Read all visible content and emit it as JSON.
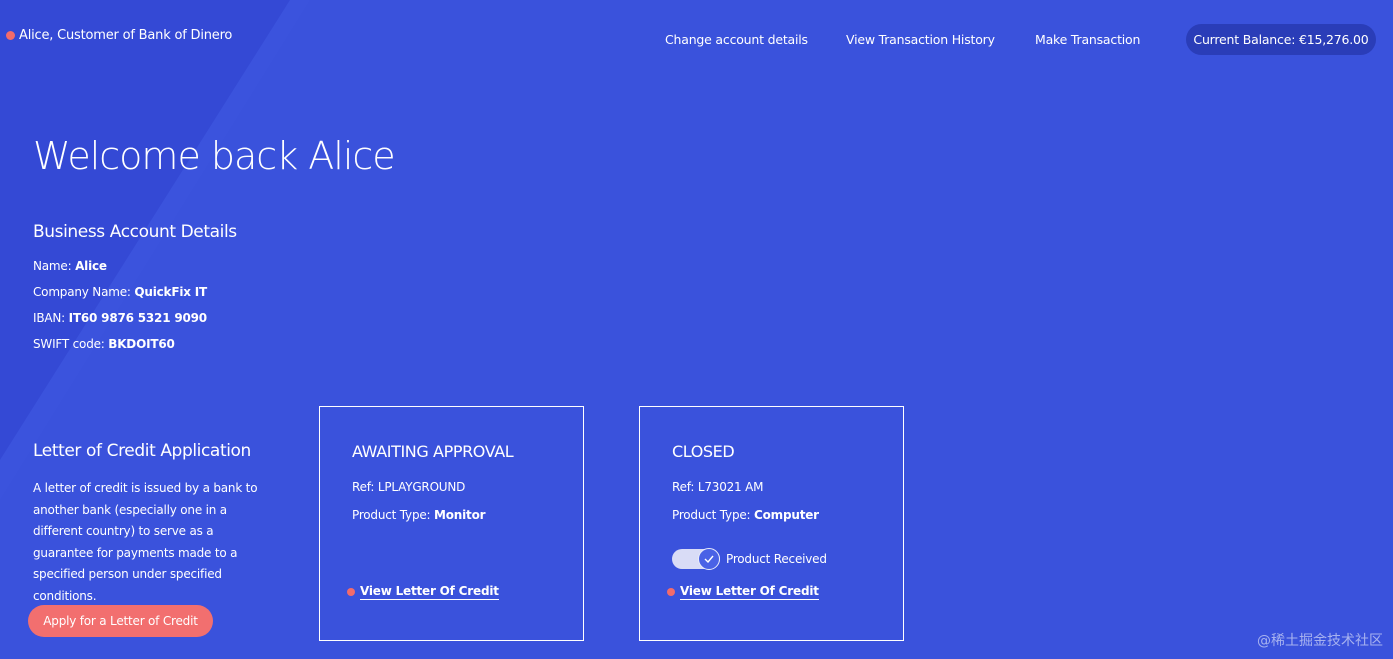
{
  "header": {
    "user_label": "Alice, Customer of Bank of Dinero",
    "nav": [
      {
        "label": "Change account details"
      },
      {
        "label": "View Transaction History"
      },
      {
        "label": "Make Transaction"
      }
    ],
    "balance_label": "Current Balance: €15,276.00"
  },
  "welcome": "Welcome back Alice",
  "account": {
    "title": "Business Account Details",
    "fields": [
      {
        "label": "Name:",
        "value": "Alice"
      },
      {
        "label": "Company Name:",
        "value": "QuickFix IT"
      },
      {
        "label": "IBAN:",
        "value": "IT60 9876 5321 9090"
      },
      {
        "label": "SWIFT code:",
        "value": "BKDOIT60"
      }
    ]
  },
  "loc": {
    "title": "Letter of Credit Application",
    "description": "A letter of credit is issued by a bank to another bank (especially one in a different country) to serve as a guarantee for payments made to a specified person under specified conditions.",
    "apply_label": "Apply for a Letter of Credit"
  },
  "cards": [
    {
      "status": "AWAITING APPROVAL",
      "ref": "Ref: LPLAYGROUND",
      "product_label": "Product Type:",
      "product_value": "Monitor",
      "view_label": "View Letter Of Credit"
    },
    {
      "status": "CLOSED",
      "ref": "Ref: L73021 AM",
      "product_label": "Product Type:",
      "product_value": "Computer",
      "toggle_label": "Product Received",
      "toggle_on": true,
      "view_label": "View Letter Of Credit"
    }
  ],
  "watermark": "@稀土掘金技术社区",
  "colors": {
    "background": "#3a52dc",
    "accent": "#f26f6f",
    "pill": "#2a3db8"
  }
}
